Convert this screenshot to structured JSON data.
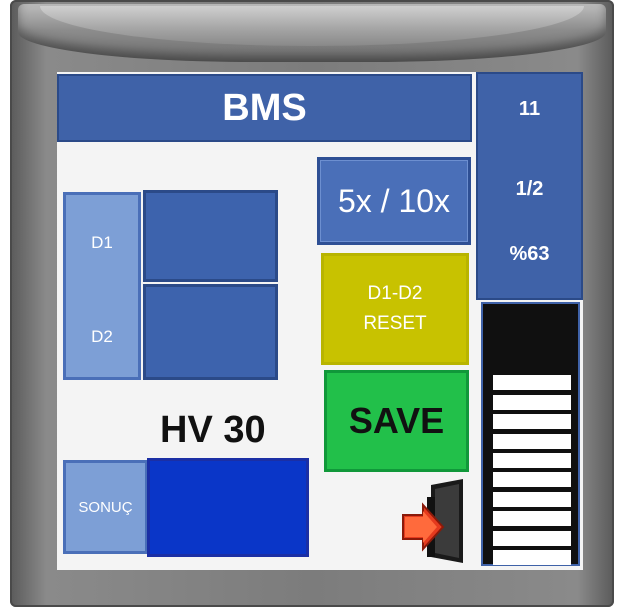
{
  "header": {
    "title": "BMS"
  },
  "status": {
    "line1": "11",
    "line2": "1/2",
    "line3": "%63"
  },
  "buttons": {
    "zoom_label": "5x / 10x",
    "reset_line1": "D1-D2",
    "reset_line2": "RESET",
    "save_label": "SAVE"
  },
  "measurements": {
    "d1_label": "D1",
    "d2_label": "D2"
  },
  "hardness": {
    "label": "HV 30"
  },
  "result": {
    "label": "SONUÇ"
  },
  "battery": {
    "level_percent": 63
  },
  "colors": {
    "panel_blue": "#3f62a8",
    "reset_yellow": "#c8c200",
    "save_green": "#22c04a",
    "result_blue": "#0a36c8"
  },
  "icons": {
    "exit": "exit-door-arrow-icon"
  }
}
